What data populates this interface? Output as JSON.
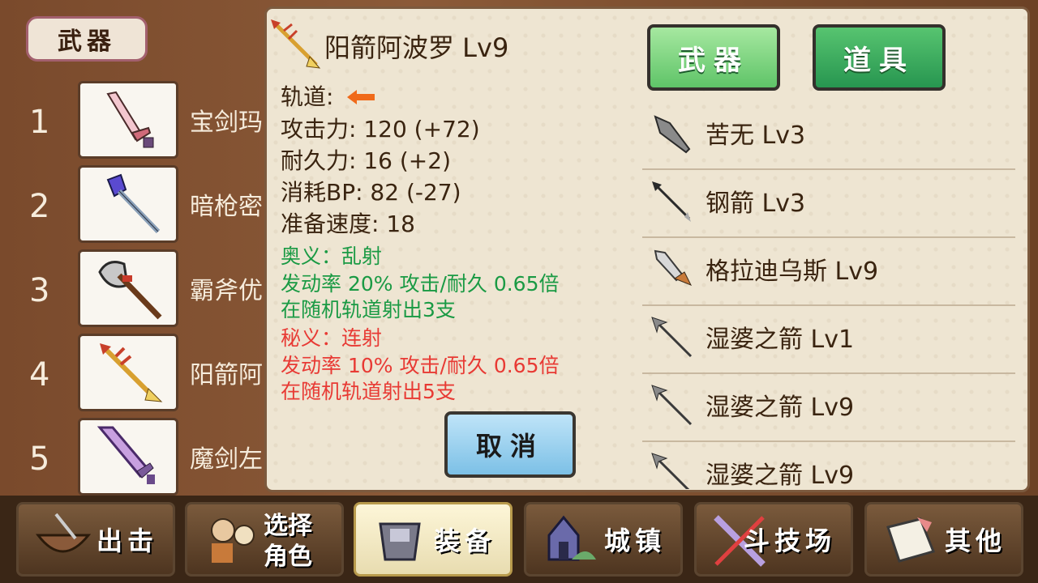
{
  "left": {
    "tab_label": "武器",
    "rows": [
      {
        "num": "1",
        "name": "宝剑玛"
      },
      {
        "num": "2",
        "name": "暗枪密"
      },
      {
        "num": "3",
        "name": "霸斧优"
      },
      {
        "num": "4",
        "name": "阳箭阿"
      },
      {
        "num": "5",
        "name": "魔剑左"
      }
    ]
  },
  "detail": {
    "title": "阳箭阿波罗 Lv9",
    "track_label": "轨道:",
    "attack": "攻击力: 120 (+72)",
    "durability": "耐久力: 16 (+2)",
    "bp": "消耗BP: 82 (-27)",
    "speed": "准备速度: 18",
    "skill1_name": "奥义：乱射",
    "skill1_line1": "发动率 20%  攻击/耐久 0.65倍",
    "skill1_line2": "在随机轨道射出3支",
    "skill2_name": "秘义：连射",
    "skill2_line1": "发动率 10%    攻击/耐久 0.65倍",
    "skill2_line2": "在随机轨道射出5支",
    "cancel_label": "取消"
  },
  "tabs": {
    "weapon": "武器",
    "item": "道具"
  },
  "items": [
    {
      "name": "苦无 Lv3"
    },
    {
      "name": "钢箭 Lv3"
    },
    {
      "name": "格拉迪乌斯 Lv9"
    },
    {
      "name": "湿婆之箭 Lv1"
    },
    {
      "name": "湿婆之箭 Lv9"
    },
    {
      "name": "湿婆之箭 Lv9"
    }
  ],
  "nav": {
    "sortie": "出击",
    "select1": "选择",
    "select2": "角色",
    "equip": "装备",
    "town": "城镇",
    "arena": "斗技场",
    "other": "其他"
  },
  "colors": {
    "accent_green": "#1a9a44",
    "accent_red": "#e83a34",
    "tab_green": "#5fc468"
  }
}
